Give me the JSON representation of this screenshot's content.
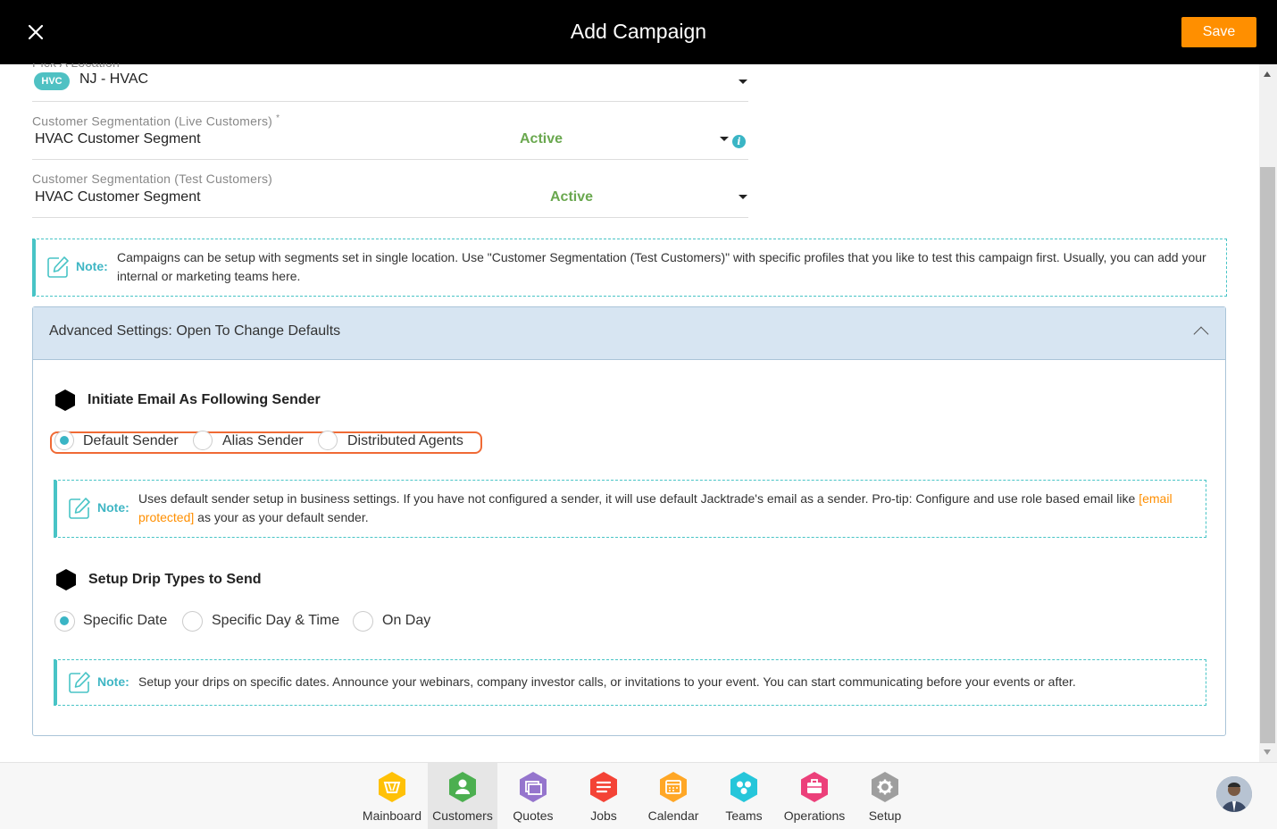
{
  "header": {
    "title": "Add Campaign",
    "save_label": "Save"
  },
  "location": {
    "label": "Pick A Location",
    "badge": "HVC",
    "value": "NJ - HVAC"
  },
  "live_segment": {
    "label": "Customer Segmentation (Live Customers)",
    "required_mark": "*",
    "value": "HVAC Customer Segment",
    "status": "Active"
  },
  "test_segment": {
    "label": "Customer Segmentation (Test Customers)",
    "value": "HVAC Customer Segment",
    "status": "Active"
  },
  "note_segments": {
    "label": "Note:",
    "text": "Campaigns can be setup with segments set in single location. Use \"Customer Segmentation (Test Customers)\" with specific profiles that you like to test this campaign first. Usually, you can add your internal or marketing teams here."
  },
  "advanced": {
    "title": "Advanced Settings: Open To Change Defaults",
    "sender": {
      "title": "Initiate Email As Following Sender",
      "options": [
        "Default Sender",
        "Alias Sender",
        "Distributed Agents"
      ],
      "selected": "Default Sender",
      "note_label": "Note:",
      "note_text": "Uses default sender setup in business settings. If you have not configured a sender, it will use default Jacktrade's email as a sender. Pro-tip: Configure and use role based email like",
      "note_link": "[email protected]",
      "note_text_2": "as your as your default sender."
    },
    "drip": {
      "title": "Setup Drip Types to Send",
      "options": [
        "Specific Date",
        "Specific Day & Time",
        "On Day"
      ],
      "selected": "Specific Date",
      "note_label": "Note:",
      "note_text": "Setup your drips on specific dates. Announce your webinars, company investor calls, or invitations to your event. You can start communicating before your events or after."
    }
  },
  "nav": {
    "items": [
      {
        "label": "Mainboard",
        "icon": "mainboard-icon",
        "color": "#ffc107"
      },
      {
        "label": "Customers",
        "icon": "customers-icon",
        "color": "#4caf50"
      },
      {
        "label": "Quotes",
        "icon": "quotes-icon",
        "color": "#9575cd"
      },
      {
        "label": "Jobs",
        "icon": "jobs-icon",
        "color": "#f44336"
      },
      {
        "label": "Calendar",
        "icon": "calendar-icon",
        "color": "#ffa726"
      },
      {
        "label": "Teams",
        "icon": "teams-icon",
        "color": "#26c6da"
      },
      {
        "label": "Operations",
        "icon": "operations-icon",
        "color": "#ec407a"
      },
      {
        "label": "Setup",
        "icon": "setup-icon",
        "color": "#9e9e9e"
      }
    ],
    "active": "Customers"
  },
  "colors": {
    "accent": "#ff8f00",
    "teal": "#3ab5c5",
    "active_green": "#6aa84f",
    "highlight": "#f06a35"
  }
}
